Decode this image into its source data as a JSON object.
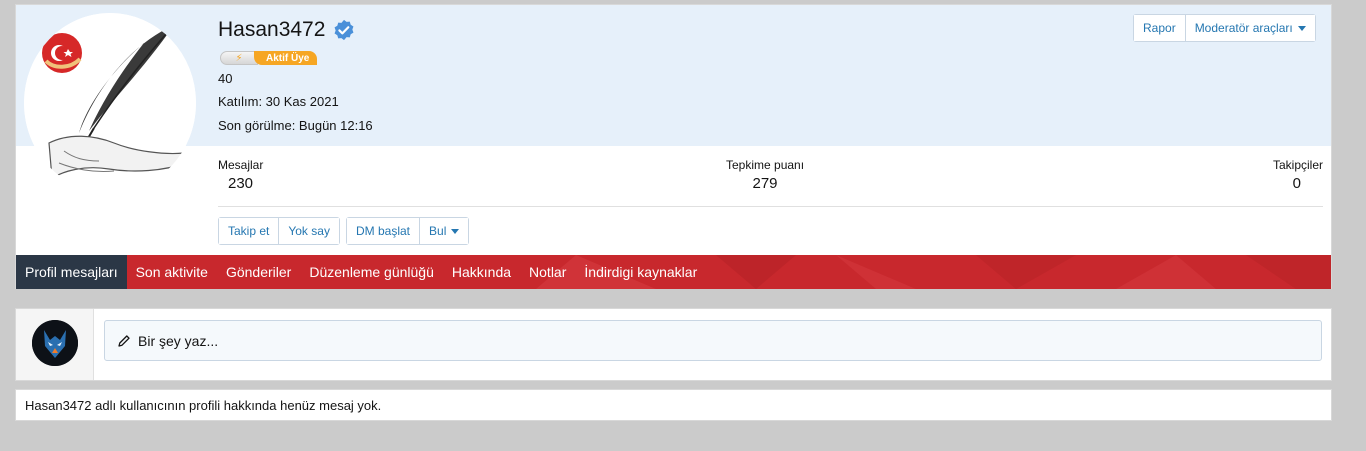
{
  "profile": {
    "username": "Hasan3472",
    "banner_bolt": "⚡",
    "role_badge": "Aktif Üye",
    "points_line": "40",
    "joined": "Katılım: 30 Kas 2021",
    "last_seen": "Son görülme: Bugün 12:16"
  },
  "top_actions": {
    "report": "Rapor",
    "moderator_tools": "Moderatör araçları"
  },
  "stats": [
    {
      "label": "Mesajlar",
      "value": "230"
    },
    {
      "label": "Tepkime puanı",
      "value": "279"
    },
    {
      "label": "Takipçiler",
      "value": "0"
    }
  ],
  "profile_actions": {
    "follow": "Takip et",
    "ignore": "Yok say",
    "start_dm": "DM başlat",
    "find": "Bul"
  },
  "tabs": [
    {
      "label": "Profil mesajları",
      "active": true
    },
    {
      "label": "Son aktivite"
    },
    {
      "label": "Gönderiler"
    },
    {
      "label": "Düzenleme günlüğü"
    },
    {
      "label": "Hakkında"
    },
    {
      "label": "Notlar"
    },
    {
      "label": "İndirdigi kaynaklar"
    }
  ],
  "composer": {
    "placeholder": "Bir şey yaz..."
  },
  "empty_message": "Hasan3472 adlı kullanıcının profili hakkında henüz mesaj yok.",
  "colors": {
    "accent_blue": "#2577b1",
    "tab_red": "#c8282d",
    "tab_active": "#2b3746",
    "badge_orange": "#f6a623",
    "header_bg": "#e6f0fa"
  }
}
